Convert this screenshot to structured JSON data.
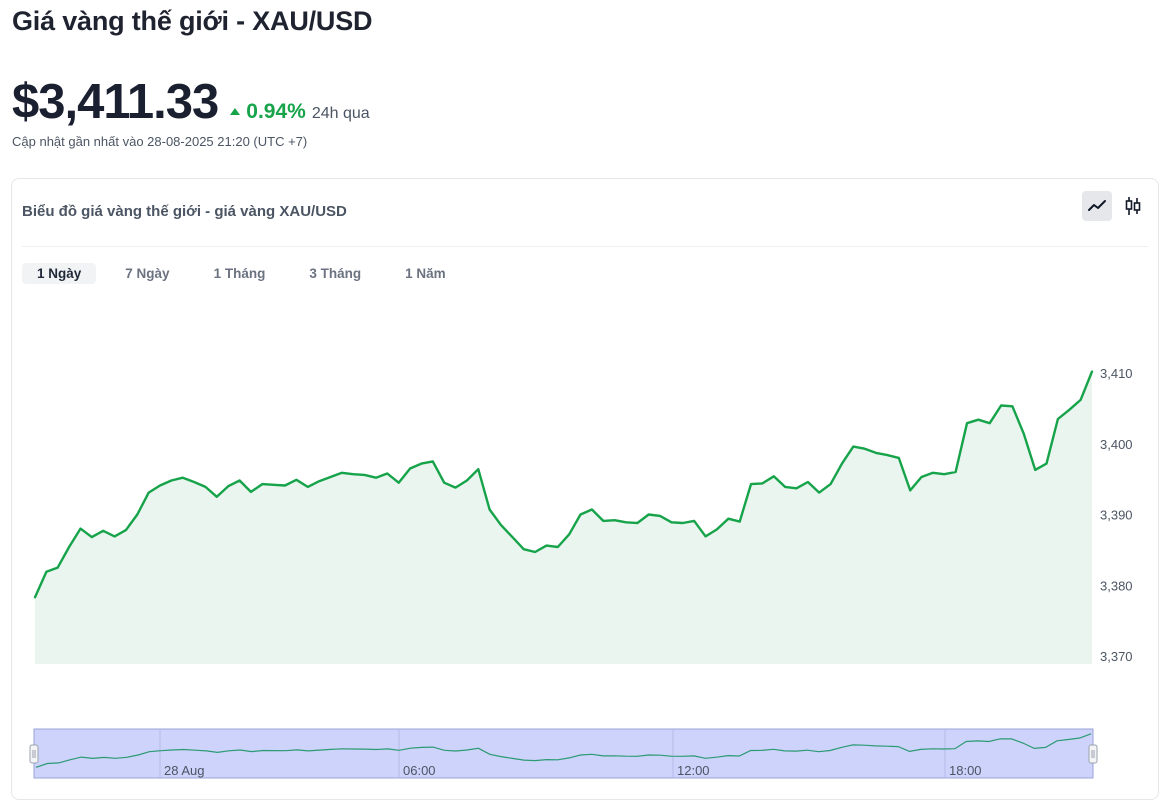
{
  "header": {
    "title": "Giá vàng thế giới - XAU/USD",
    "price": "$3,411.33",
    "change": "0.94%",
    "period": "24h qua",
    "updated": "Cập nhật gần nhất vào 28-08-2025 21:20 (UTC +7)"
  },
  "card": {
    "title": "Biểu đồ giá vàng thế giới - giá vàng XAU/USD",
    "chart_types": [
      {
        "name": "line-chart-icon",
        "active": true
      },
      {
        "name": "candlestick-icon",
        "active": false
      }
    ],
    "ranges": [
      {
        "label": "1 Ngày",
        "active": true
      },
      {
        "label": "7 Ngày",
        "active": false
      },
      {
        "label": "1 Tháng",
        "active": false
      },
      {
        "label": "3 Tháng",
        "active": false
      },
      {
        "label": "1 Năm",
        "active": false
      }
    ]
  },
  "colors": {
    "line": "#16a34a",
    "area": "#e9f5ee",
    "up": "#16a34a",
    "navigator_fill": "#cdd3fb",
    "navigator_line": "#2c9a73"
  },
  "chart_data": {
    "type": "area",
    "title": "",
    "xlabel": "",
    "ylabel": "",
    "ylim": [
      3370,
      3410
    ],
    "y_ticks": [
      3410,
      3400,
      3390,
      3380,
      3370
    ],
    "y_tick_labels": [
      "3,410",
      "3,400",
      "3,390",
      "3,380",
      "3,370"
    ],
    "navigator_labels": [
      "28 Aug",
      "06:00",
      "12:00",
      "18:00"
    ],
    "series": [
      {
        "values": [
          3378.3,
          3381.9,
          3382.5,
          3385.4,
          3388.0,
          3386.8,
          3387.7,
          3386.9,
          3387.8,
          3390.0,
          3393.1,
          3394.1,
          3394.8,
          3395.2,
          3394.6,
          3393.9,
          3392.5,
          3394.0,
          3394.8,
          3393.2,
          3394.3,
          3394.2,
          3394.1,
          3394.9,
          3393.9,
          3394.7,
          3395.3,
          3395.9,
          3395.7,
          3395.6,
          3395.2,
          3395.8,
          3394.5,
          3396.5,
          3397.2,
          3397.5,
          3394.5,
          3393.8,
          3394.8,
          3396.4,
          3390.7,
          3388.5,
          3386.8,
          3385.1,
          3384.7,
          3385.6,
          3385.4,
          3387.2,
          3390.0,
          3390.7,
          3389.1,
          3389.2,
          3388.9,
          3388.8,
          3390.0,
          3389.8,
          3388.9,
          3388.8,
          3389.1,
          3386.9,
          3387.9,
          3389.4,
          3389.0,
          3394.3,
          3394.4,
          3395.4,
          3393.9,
          3393.7,
          3394.6,
          3393.1,
          3394.3,
          3397.2,
          3399.6,
          3399.3,
          3398.7,
          3398.4,
          3398.0,
          3393.4,
          3395.3,
          3395.9,
          3395.7,
          3396.0,
          3402.9,
          3403.4,
          3402.9,
          3405.4,
          3405.3,
          3401.4,
          3396.3,
          3397.2,
          3403.5,
          3404.8,
          3406.2,
          3410.2
        ]
      }
    ]
  }
}
